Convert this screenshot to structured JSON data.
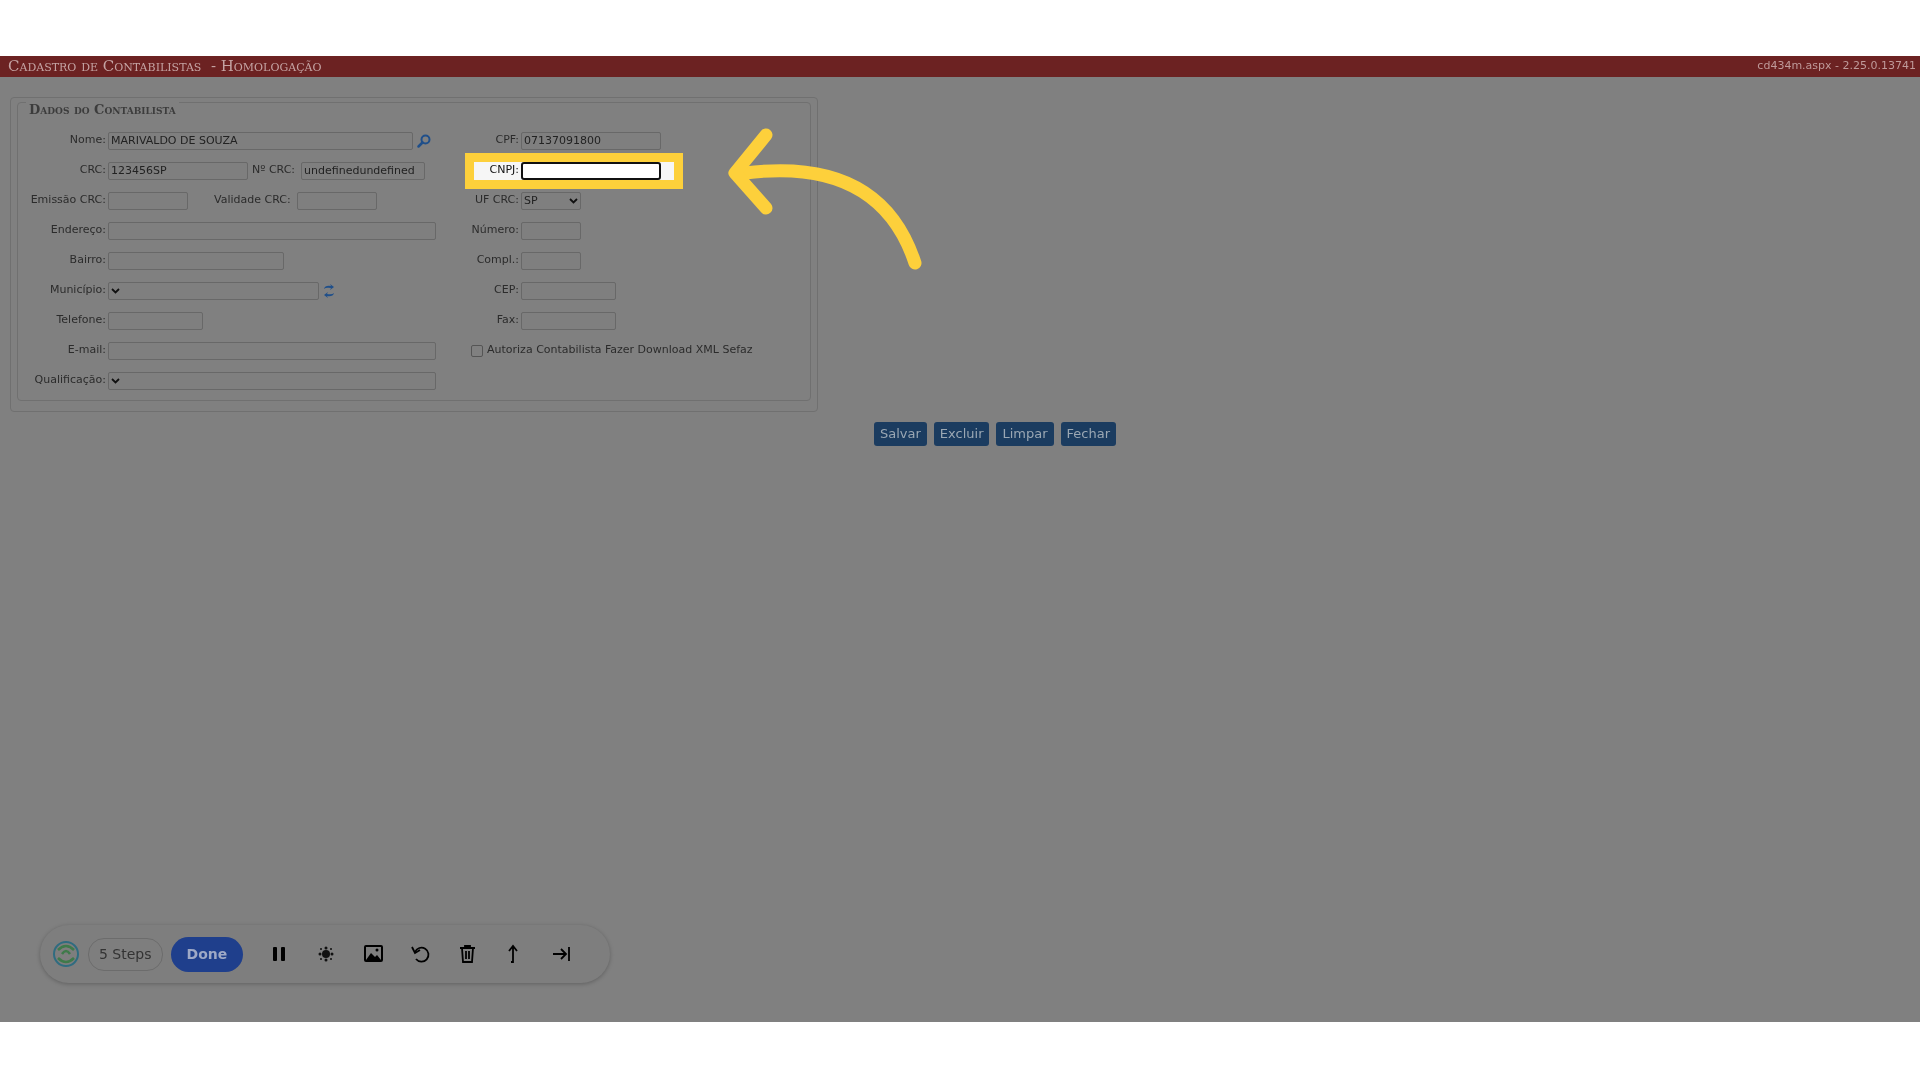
{
  "header": {
    "title": "Cadastro de Contabilistas  - Homologação",
    "version": "cd434m.aspx - 2.25.0.13741"
  },
  "fieldset": {
    "legend": "Dados do Contabilista",
    "rows": [
      {
        "left": [
          {
            "kind": "input",
            "label": "Nome:",
            "value": "MARIVALDO DE SOUZA"
          },
          {
            "kind": "search_button"
          }
        ],
        "right": {
          "kind": "input",
          "label": "CPF:",
          "value": "07137091800"
        }
      },
      {
        "left": [
          {
            "kind": "input",
            "label": "CRC:",
            "value": "123456SP"
          },
          {
            "kind": "input",
            "label": "Nº CRC:",
            "value": "undefinedundefined"
          }
        ],
        "right": {
          "kind": "input",
          "label": "CNPJ:",
          "highlighted": true
        }
      },
      {
        "left": [
          {
            "kind": "input",
            "label": "Emissão CRC:"
          },
          {
            "kind": "input",
            "label": "Validade CRC:"
          }
        ],
        "right": {
          "kind": "select",
          "label": "UF CRC:",
          "value": "SP"
        }
      },
      {
        "left": [
          {
            "kind": "input",
            "label": "Endereço:"
          }
        ],
        "right": {
          "kind": "input",
          "label": "Número:"
        }
      },
      {
        "left": [
          {
            "kind": "input",
            "label": "Bairro:"
          }
        ],
        "right": {
          "kind": "input",
          "label": "Compl.:"
        }
      },
      {
        "left": [
          {
            "kind": "select",
            "label": "Município:"
          },
          {
            "kind": "refresh_button"
          }
        ],
        "right": {
          "kind": "input",
          "label": "CEP:"
        }
      },
      {
        "left": [
          {
            "kind": "input",
            "label": "Telefone:"
          }
        ],
        "right": {
          "kind": "input",
          "label": "Fax:"
        }
      },
      {
        "left": [
          {
            "kind": "input",
            "label": "E-mail:"
          }
        ],
        "right": {
          "kind": "checkbox",
          "label": "Autoriza Contabilista Fazer Download XML Sefaz",
          "checked": false
        }
      },
      {
        "left": [
          {
            "kind": "select",
            "label": "Qualificação:"
          }
        ]
      }
    ]
  },
  "buttons": [
    "Salvar",
    "Excluir",
    "Limpar",
    "Fechar"
  ],
  "toolbar": {
    "steps": "5 Steps",
    "done": "Done"
  }
}
